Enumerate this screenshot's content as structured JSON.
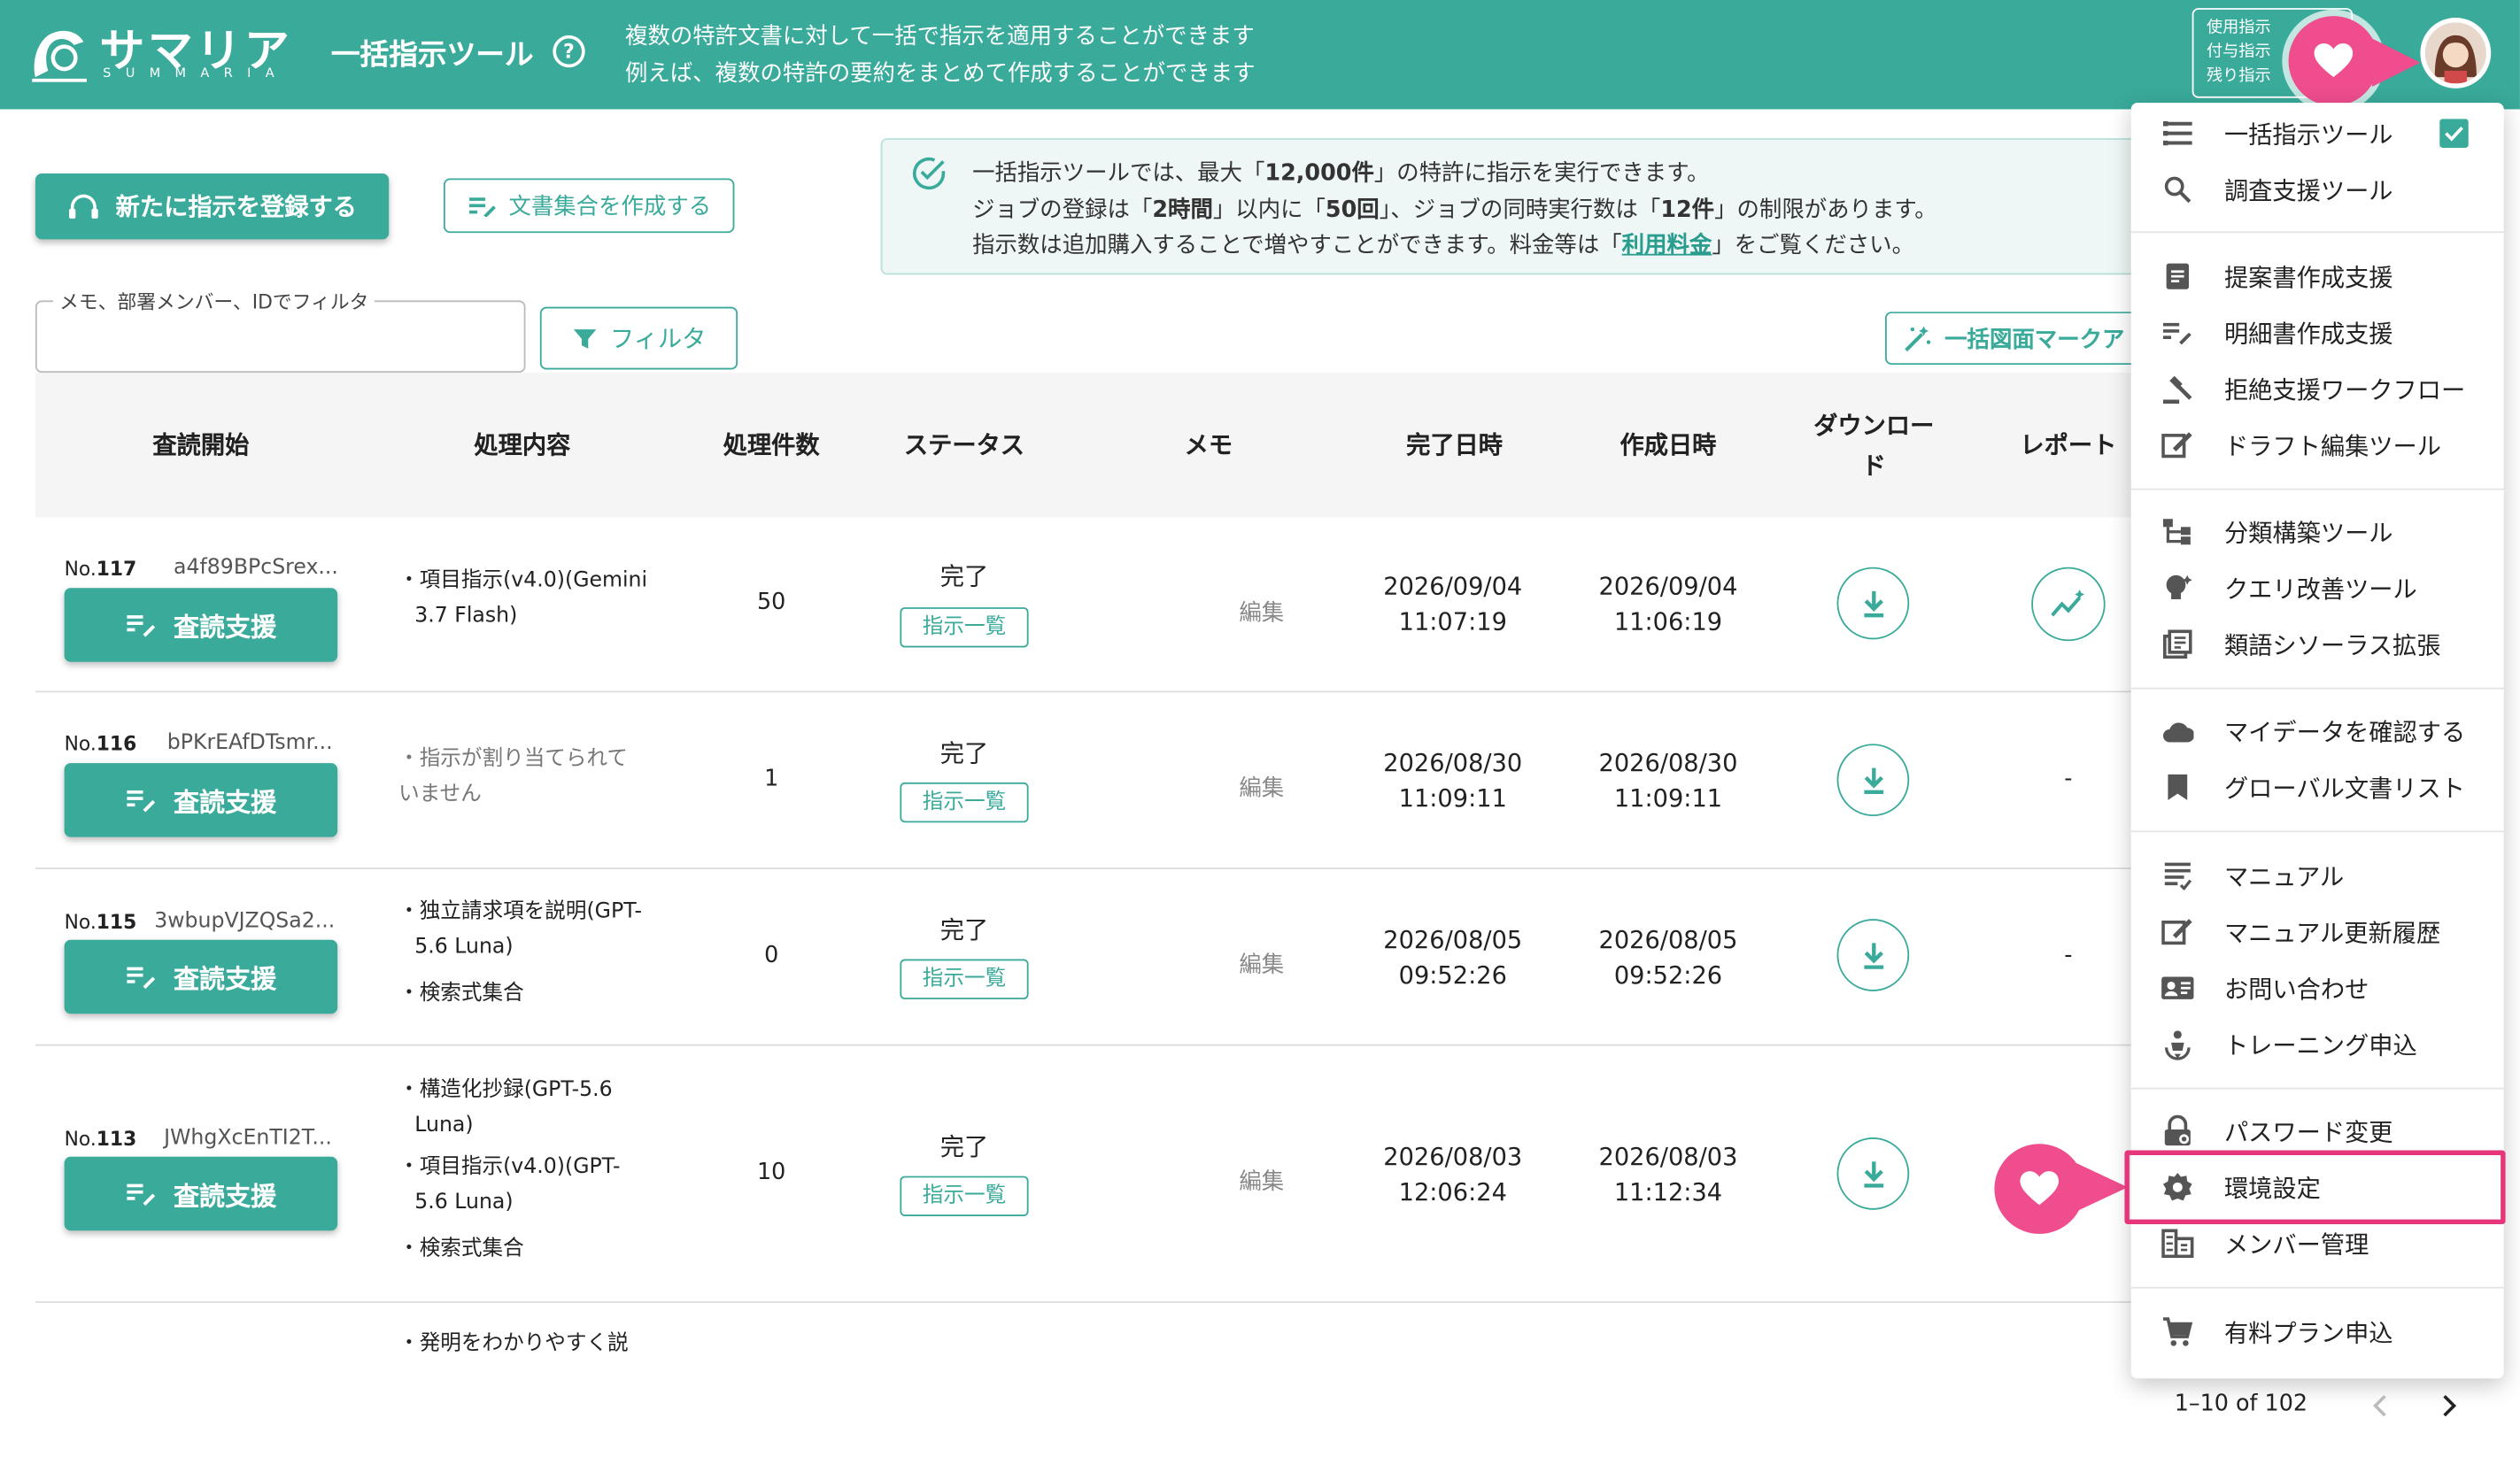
{
  "header": {
    "logo_jp": "サマリア",
    "logo_en": "SUMMARIA",
    "tool_title": "一括指示ツール",
    "help": "?",
    "desc_line1": "複数の特許文書に対して一括で指示を適用することができます",
    "desc_line2": "例えば、複数の特許の要約をまとめて作成することができます",
    "usage_line1": "使用指示",
    "usage_line2": "付与指示",
    "usage_line3": "残り指示"
  },
  "actions": {
    "new_instruction": "新たに指示を登録する",
    "create_doc_set": "文書集合を作成する",
    "filter_label": "メモ、部署メンバー、IDでフィルタ",
    "filter_button": "フィルタ",
    "bulk_mark": "一括図面マークア"
  },
  "info": {
    "l1a": "一括指示ツールでは、最大「",
    "l1b": "12,000件",
    "l1c": "」の特許に指示を実行できます。",
    "l2a": "ジョブの登録は「",
    "l2b": "2時間",
    "l2c": "」以内に「",
    "l2d": "50回",
    "l2e": "」、ジョブの同時実行数は「",
    "l2f": "12件",
    "l2g": "」の制限があります。",
    "l3a": "指示数は追加購入することで増やすことができます。料金等は「",
    "l3b": "利用料金",
    "l3c": "」をご覧ください。"
  },
  "columns": {
    "start": "査読開始",
    "process": "処理内容",
    "count": "処理件数",
    "status": "ステータス",
    "memo": "メモ",
    "done": "完了日時",
    "created": "作成日時",
    "download1": "ダウンロー",
    "download2": "ド",
    "report": "レポート"
  },
  "rows": [
    {
      "no_prefix": "No.",
      "no": "117",
      "id": "a4f89BPcSrex...",
      "proc1": "・項目指示(v4.0)(Gemini",
      "proc2": "3.7 Flash)",
      "count": "50",
      "status": "完了",
      "chip": "指示一覧",
      "memo": "編集",
      "done_d": "2026/09/04",
      "done_t": "11:07:19",
      "created_d": "2026/09/04",
      "created_t": "11:06:19",
      "button": "査読支援"
    },
    {
      "no_prefix": "No.",
      "no": "116",
      "id": "bPKrEAfDTsmr...",
      "proc1": "・指示が割り当てられて",
      "proc2": "いません",
      "count": "1",
      "status": "完了",
      "chip": "指示一覧",
      "memo": "編集",
      "done_d": "2026/08/30",
      "done_t": "11:09:11",
      "created_d": "2026/08/30",
      "created_t": "11:09:11",
      "report": "-",
      "button": "査読支援"
    },
    {
      "no_prefix": "No.",
      "no": "115",
      "id": "3wbupVJZQSa2...",
      "proc1": "・独立請求項を説明(GPT-",
      "proc2": "5.6 Luna)",
      "proc3": "・検索式集合",
      "count": "0",
      "status": "完了",
      "chip": "指示一覧",
      "memo": "編集",
      "done_d": "2026/08/05",
      "done_t": "09:52:26",
      "created_d": "2026/08/05",
      "created_t": "09:52:26",
      "report": "-",
      "button": "査読支援"
    },
    {
      "no_prefix": "No.",
      "no": "113",
      "id": "JWhgXcEnTI2T...",
      "proc1": "・構造化抄録(GPT-5.6",
      "proc2": "Luna)",
      "proc3": "・項目指示(v4.0)(GPT-",
      "proc4": "5.6 Luna)",
      "proc5": "・検索式集合",
      "count": "10",
      "status": "完了",
      "chip": "指示一覧",
      "memo": "編集",
      "done_d": "2026/08/03",
      "done_t": "12:06:24",
      "created_d": "2026/08/03",
      "created_t": "11:12:34",
      "button": "査読支援"
    }
  ],
  "partial_row": {
    "proc1": "・発明をわかりやすく説"
  },
  "menu": {
    "items": [
      {
        "label": "一括指示ツール",
        "icon": "list-icon"
      },
      {
        "label": "調査支援ツール",
        "icon": "search-icon"
      },
      {
        "label": "提案書作成支援",
        "icon": "document-icon"
      },
      {
        "label": "明細書作成支援",
        "icon": "edit-list-icon"
      },
      {
        "label": "拒絶支援ワークフロー",
        "icon": "gavel-icon"
      },
      {
        "label": "ドラフト編集ツール",
        "icon": "draft-icon"
      },
      {
        "label": "分類構築ツール",
        "icon": "tree-icon"
      },
      {
        "label": "クエリ改善ツール",
        "icon": "bulb-icon"
      },
      {
        "label": "類語シソーラス拡張",
        "icon": "library-icon"
      },
      {
        "label": "マイデータを確認する",
        "icon": "cloud-icon"
      },
      {
        "label": "グローバル文書リスト",
        "icon": "bookmark-icon"
      },
      {
        "label": "マニュアル",
        "icon": "manual-icon"
      },
      {
        "label": "マニュアル更新履歴",
        "icon": "history-icon"
      },
      {
        "label": "お問い合わせ",
        "icon": "contact-icon"
      },
      {
        "label": "トレーニング申込",
        "icon": "training-icon"
      },
      {
        "label": "パスワード変更",
        "icon": "lock-icon"
      },
      {
        "label": "環境設定",
        "icon": "gear-icon"
      },
      {
        "label": "メンバー管理",
        "icon": "members-icon"
      },
      {
        "label": "有料プラン申込",
        "icon": "cart-icon"
      }
    ]
  },
  "pager": {
    "range": "1–10 of 102"
  },
  "colors": {
    "accent": "#3aaa9b",
    "highlight": "#e6357a"
  }
}
